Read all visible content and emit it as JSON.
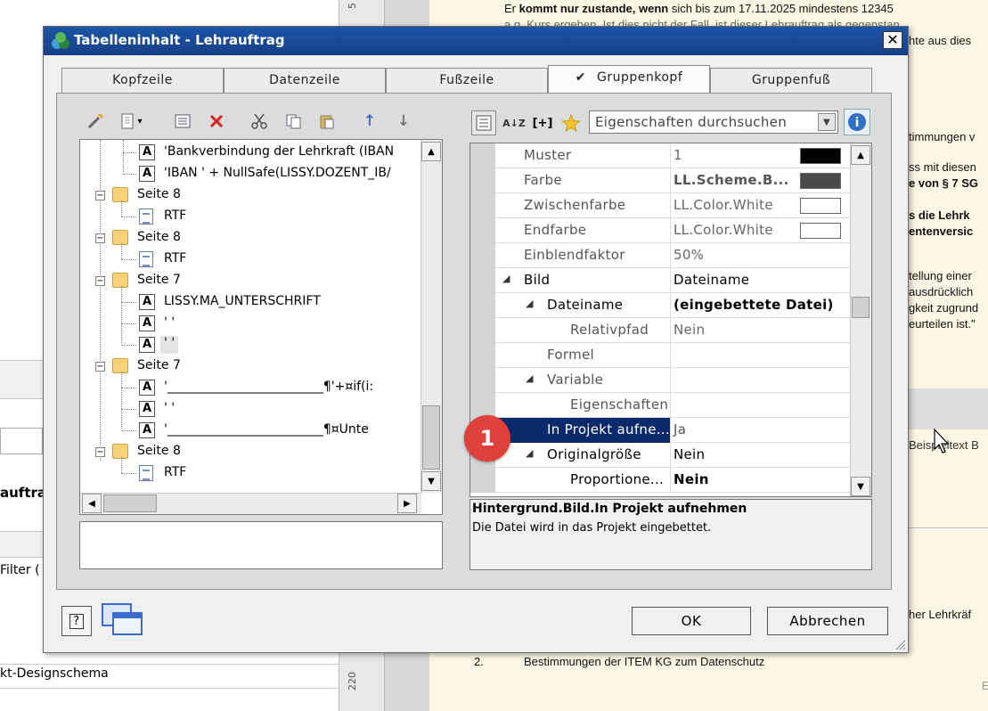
{
  "window": {
    "title": "Tabelleninhalt - Lehrauftrag",
    "close_glyph": "✕"
  },
  "tabs": [
    {
      "label": "Kopfzeile"
    },
    {
      "label": "Datenzeile"
    },
    {
      "label": "Fußzeile"
    },
    {
      "label": "Gruppenkopf",
      "check": "✔"
    },
    {
      "label": "Gruppenfuß"
    }
  ],
  "tree": {
    "rows": [
      {
        "text": "'Bankverbindung der Lehrkraft (IBAN",
        "icon": "A"
      },
      {
        "text": "'IBAN  ' +   NullSafe(LISSY.DOZENT_IB/",
        "icon": "A"
      },
      {
        "text": "Seite 8",
        "expander": "−"
      },
      {
        "text": "RTF"
      },
      {
        "text": "Seite 8",
        "expander": "−"
      },
      {
        "text": "RTF"
      },
      {
        "text": "Seite 7",
        "expander": "−"
      },
      {
        "text": "LISSY.MA_UNTERSCHRIFT",
        "icon": "A"
      },
      {
        "text": "' '",
        "icon": "A"
      },
      {
        "text": "' '",
        "icon": "A"
      },
      {
        "text": "Seite 7",
        "expander": "−"
      },
      {
        "text": "'_________________________¶'+¤if(i:",
        "icon": "A"
      },
      {
        "text": "' '",
        "icon": "A"
      },
      {
        "text": "'_________________________¶¤Unte",
        "icon": "A"
      },
      {
        "text": "Seite 8",
        "expander": "−"
      },
      {
        "text": "RTF"
      }
    ]
  },
  "toolbar_glyphs": {
    "dropdown": "▾",
    "arrow_up": "↑",
    "arrow_down": "↓",
    "sort": "A↓Z",
    "expand": "[+]",
    "info": "i",
    "scroll_up": "▲",
    "scroll_down": "▼",
    "scroll_left": "◀",
    "scroll_right": "▶",
    "search_drop": "▼"
  },
  "properties": {
    "search_placeholder": "Eigenschaften durchsuchen",
    "rows": [
      {
        "name": "Muster",
        "value": "1",
        "swatch": "#000000"
      },
      {
        "name": "Farbe",
        "value": "LL.Scheme.B...",
        "swatch": "#4a4a4a",
        "bold": true
      },
      {
        "name": "Zwischenfarbe",
        "value": "LL.Color.White",
        "swatch": "#ffffff"
      },
      {
        "name": "Endfarbe",
        "value": "LL.Color.White",
        "swatch": "#ffffff"
      },
      {
        "name": "Einblendfaktor",
        "value": "50%"
      },
      {
        "name": "Bild",
        "value": "Dateiname",
        "expander": "◢",
        "nameBold": true
      },
      {
        "name": "Dateiname",
        "value": "(eingebettete Datei)",
        "expander": "◢",
        "bold": true
      },
      {
        "name": "Relativpfad",
        "value": "Nein"
      },
      {
        "name": "Formel",
        "value": ""
      },
      {
        "name": "Variable",
        "value": "",
        "expander": "◢"
      },
      {
        "name": "Eigenschaften",
        "value": ""
      },
      {
        "name": "In Projekt aufne...",
        "value": "Ja",
        "selected": true
      },
      {
        "name": "Originalgröße",
        "value": "Nein",
        "expander": "◢"
      },
      {
        "name": "Proportione...",
        "value": "Nein",
        "bold": true
      }
    ],
    "description_title": "Hintergrund.Bild.In Projekt aufnehmen",
    "description_text": "Die Datei wird in das Projekt eingebettet."
  },
  "badge": {
    "number": "1"
  },
  "buttons": {
    "help": "?",
    "ok": "OK",
    "cancel": "Abbrechen"
  },
  "background": {
    "doc_lines": [
      {
        "t": "Er kommt nur zustande, wenn sich bis zum 17.11.2025 mindestens 12345"
      },
      {
        "t": "a.g. Kurs ergeben. Ist dies nicht der Fall, ist dieser Lehrauftrag als gegenstan"
      },
      {
        "t": "hte aus dies"
      },
      {
        "t": "timmungen v"
      },
      {
        "t": "ss mit diesen"
      },
      {
        "t": "e von § 7 SG"
      },
      {
        "t": "s die Lehrk"
      },
      {
        "t": "entenversic"
      },
      {
        "t": "tellung einer"
      },
      {
        "t": "ausdrücklich"
      },
      {
        "t": "gkeit zugrund"
      },
      {
        "t": "eurteilen ist.\""
      },
      {
        "t": "Beispieltext B"
      },
      {
        "t": "her Lehrkräf"
      },
      {
        "t": "Bestimmungen der ITEM KG zum Datenschutz",
        "num": "2."
      },
      {
        "t": "E"
      }
    ],
    "left_texts": [
      "auftra",
      "Filter (",
      "kt-Designschema"
    ],
    "ruler_labels": [
      "5",
      "220"
    ]
  }
}
